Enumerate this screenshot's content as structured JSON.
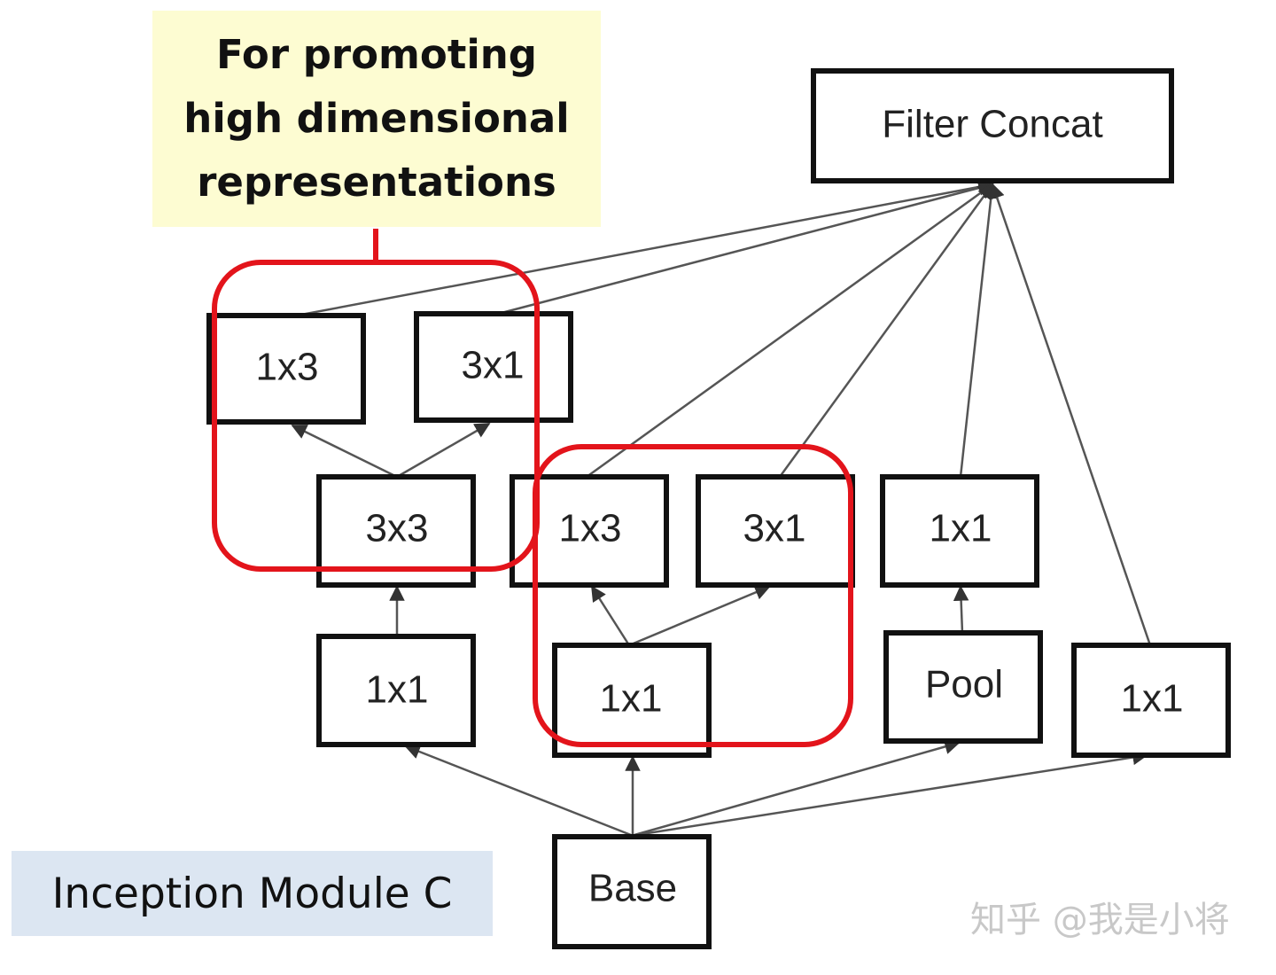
{
  "annotation_top": {
    "lines": [
      "For promoting",
      "high dimensional",
      "representations"
    ]
  },
  "annotation_bottom": {
    "label": "Inception Module C"
  },
  "watermark": {
    "text": "知乎 @我是小将"
  },
  "nodes": {
    "filter_concat": "Filter Concat",
    "b1_1x3": "1x3",
    "b1_3x1": "3x1",
    "b1_3x3": "3x3",
    "b1_1x1": "1x1",
    "b2_1x3": "1x3",
    "b2_3x1": "3x1",
    "b2_1x1": "1x1",
    "b3_1x1": "1x1",
    "b3_pool": "Pool",
    "b4_1x1": "1x1",
    "base": "Base"
  },
  "colors": {
    "highlight": "#e3141b",
    "box_stroke": "#111111",
    "edge": "#555555"
  }
}
